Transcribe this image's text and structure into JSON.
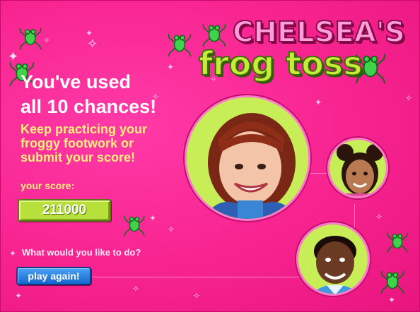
{
  "game": {
    "title_line1": "CHELSEA'S",
    "title_line2": "frog toss"
  },
  "result": {
    "headline_line1": "You've used",
    "headline_line2": "all 10 chances!",
    "message_line1": "Keep practicing your",
    "message_line2": "froggy footwork or",
    "message_line3": "submit your score!",
    "score_label": "your score:",
    "score_value": "211000"
  },
  "actions": {
    "question": "What would you like to do?",
    "play_again_label": "play again!"
  },
  "colors": {
    "background": "#f7238f",
    "title_pink": "#ff9ed8",
    "title_green": "#c6ec3a",
    "message_yellow": "#fff07a",
    "score_box_green": "#b8e03a",
    "button_blue": "#1567cf"
  },
  "icons": {
    "frog": "frog-icon",
    "sparkle": "sparkle-icon"
  }
}
